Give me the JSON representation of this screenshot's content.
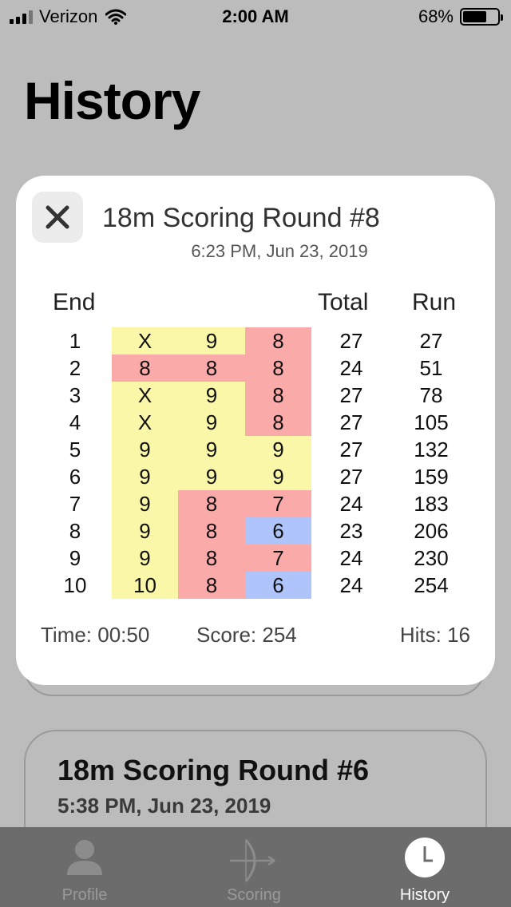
{
  "status_bar": {
    "carrier": "Verizon",
    "time": "2:00 AM",
    "battery_percent": "68%",
    "battery_level": 0.68
  },
  "page": {
    "title": "History"
  },
  "modal": {
    "title": "18m Scoring Round #8",
    "date": "6:23 PM, Jun 23, 2019",
    "headers": {
      "end": "End",
      "total": "Total",
      "run": "Run"
    },
    "colors": {
      "gold": "#fbf7a8",
      "red": "#fbaaaa",
      "blue": "#afc4fb"
    },
    "ends": [
      {
        "end": "1",
        "arrows": [
          "X",
          "9",
          "8"
        ],
        "zones": [
          "gold",
          "gold",
          "red"
        ],
        "total": "27",
        "run": "27"
      },
      {
        "end": "2",
        "arrows": [
          "8",
          "8",
          "8"
        ],
        "zones": [
          "red",
          "red",
          "red"
        ],
        "total": "24",
        "run": "51"
      },
      {
        "end": "3",
        "arrows": [
          "X",
          "9",
          "8"
        ],
        "zones": [
          "gold",
          "gold",
          "red"
        ],
        "total": "27",
        "run": "78"
      },
      {
        "end": "4",
        "arrows": [
          "X",
          "9",
          "8"
        ],
        "zones": [
          "gold",
          "gold",
          "red"
        ],
        "total": "27",
        "run": "105"
      },
      {
        "end": "5",
        "arrows": [
          "9",
          "9",
          "9"
        ],
        "zones": [
          "gold",
          "gold",
          "gold"
        ],
        "total": "27",
        "run": "132"
      },
      {
        "end": "6",
        "arrows": [
          "9",
          "9",
          "9"
        ],
        "zones": [
          "gold",
          "gold",
          "gold"
        ],
        "total": "27",
        "run": "159"
      },
      {
        "end": "7",
        "arrows": [
          "9",
          "8",
          "7"
        ],
        "zones": [
          "gold",
          "red",
          "red"
        ],
        "total": "24",
        "run": "183"
      },
      {
        "end": "8",
        "arrows": [
          "9",
          "8",
          "6"
        ],
        "zones": [
          "gold",
          "red",
          "blue"
        ],
        "total": "23",
        "run": "206"
      },
      {
        "end": "9",
        "arrows": [
          "9",
          "8",
          "7"
        ],
        "zones": [
          "gold",
          "red",
          "red"
        ],
        "total": "24",
        "run": "230"
      },
      {
        "end": "10",
        "arrows": [
          "10",
          "8",
          "6"
        ],
        "zones": [
          "gold",
          "red",
          "blue"
        ],
        "total": "24",
        "run": "254"
      }
    ],
    "footer": {
      "time": "Time: 00:50",
      "score": "Score: 254",
      "hits": "Hits: 16"
    }
  },
  "history_items": [
    {
      "title": "18m Scoring Round #6",
      "date": "5:38 PM, Jun 23, 2019"
    }
  ],
  "tab_bar": {
    "tabs": [
      {
        "label": "Profile",
        "icon": "person-icon",
        "active": false
      },
      {
        "label": "Scoring",
        "icon": "bow-arrow-icon",
        "active": false
      },
      {
        "label": "History",
        "icon": "clock-icon",
        "active": true
      }
    ]
  }
}
